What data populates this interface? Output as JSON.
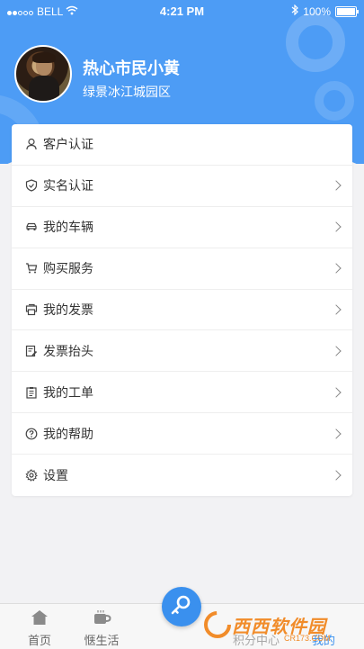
{
  "status_bar": {
    "carrier": "BELL",
    "time": "4:21 PM",
    "battery": "100%",
    "battery_level": 1.0
  },
  "profile": {
    "name": "热心市民小黄",
    "community": "绿景冰江城园区"
  },
  "menu": {
    "items": [
      {
        "label": "客户认证",
        "icon": "person-icon",
        "has_chevron": false
      },
      {
        "label": "实名认证",
        "icon": "shield-icon",
        "has_chevron": true
      },
      {
        "label": "我的车辆",
        "icon": "car-icon",
        "has_chevron": true
      },
      {
        "label": "购买服务",
        "icon": "cart-icon",
        "has_chevron": true
      },
      {
        "label": "我的发票",
        "icon": "printer-icon",
        "has_chevron": true
      },
      {
        "label": "发票抬头",
        "icon": "document-edit-icon",
        "has_chevron": true
      },
      {
        "label": "我的工单",
        "icon": "clipboard-icon",
        "has_chevron": true
      },
      {
        "label": "我的帮助",
        "icon": "help-icon",
        "has_chevron": true
      },
      {
        "label": "设置",
        "icon": "gear-icon",
        "has_chevron": true
      }
    ]
  },
  "tabbar": {
    "tabs": [
      {
        "label": "首页",
        "icon": "home-icon"
      },
      {
        "label": "惬生活",
        "icon": "coffee-icon"
      },
      {
        "label": "积分中心",
        "icon": "points-icon"
      },
      {
        "label": "我的",
        "icon": "profile-icon"
      }
    ],
    "fab_icon": "key-icon"
  },
  "watermark": {
    "text": "西西软件园",
    "url": "CR173.COM"
  },
  "colors": {
    "primary": "#4d9cf5",
    "background": "#f2f2f4",
    "tab_active": "#3a90ee"
  }
}
